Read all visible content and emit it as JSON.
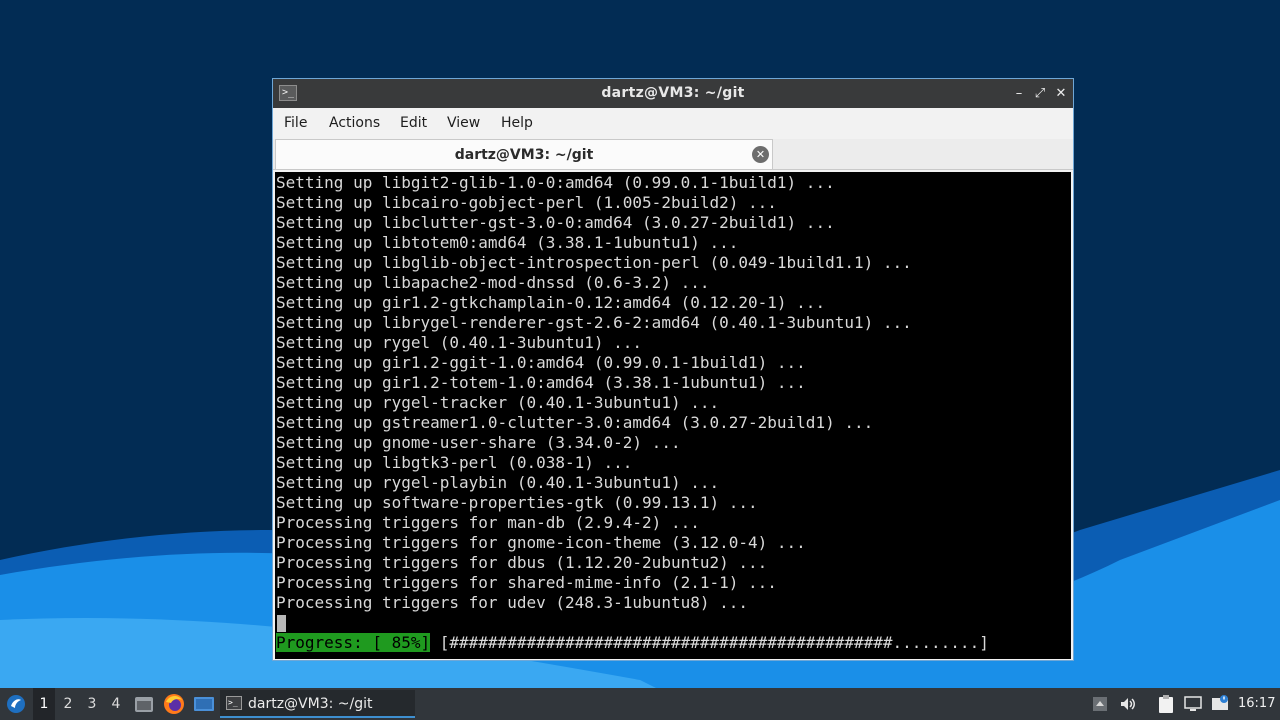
{
  "window": {
    "title": "dartz@VM3: ~/git",
    "controls": {
      "minimize": "–",
      "maximize": "⤢",
      "close": "✕"
    }
  },
  "menu": [
    "File",
    "Actions",
    "Edit",
    "View",
    "Help"
  ],
  "tab": {
    "title": "dartz@VM3: ~/git",
    "close": "✕"
  },
  "terminal": {
    "lines": [
      "Setting up libgit2-glib-1.0-0:amd64 (0.99.0.1-1build1) ...",
      "Setting up libcairo-gobject-perl (1.005-2build2) ...",
      "Setting up libclutter-gst-3.0-0:amd64 (3.0.27-2build1) ...",
      "Setting up libtotem0:amd64 (3.38.1-1ubuntu1) ...",
      "Setting up libglib-object-introspection-perl (0.049-1build1.1) ...",
      "Setting up libapache2-mod-dnssd (0.6-3.2) ...",
      "Setting up gir1.2-gtkchamplain-0.12:amd64 (0.12.20-1) ...",
      "Setting up librygel-renderer-gst-2.6-2:amd64 (0.40.1-3ubuntu1) ...",
      "Setting up rygel (0.40.1-3ubuntu1) ...",
      "Setting up gir1.2-ggit-1.0:amd64 (0.99.0.1-1build1) ...",
      "Setting up gir1.2-totem-1.0:amd64 (3.38.1-1ubuntu1) ...",
      "Setting up rygel-tracker (0.40.1-3ubuntu1) ...",
      "Setting up gstreamer1.0-clutter-3.0:amd64 (3.0.27-2build1) ...",
      "Setting up gnome-user-share (3.34.0-2) ...",
      "Setting up libgtk3-perl (0.038-1) ...",
      "Setting up rygel-playbin (0.40.1-3ubuntu1) ...",
      "Setting up software-properties-gtk (0.99.13.1) ...",
      "Processing triggers for man-db (2.9.4-2) ...",
      "Processing triggers for gnome-icon-theme (3.12.0-4) ...",
      "Processing triggers for dbus (1.12.20-2ubuntu2) ...",
      "Processing triggers for shared-mime-info (2.1-1) ...",
      "Processing triggers for udev (248.3-1ubuntu8) ..."
    ],
    "progress_label": "Progress: [ 85%]",
    "progress_bar": " [##############################################.........]",
    "progress_percent": 85
  },
  "taskbar": {
    "workspaces": [
      "1",
      "2",
      "3",
      "4"
    ],
    "active_workspace": "1",
    "task_label": "dartz@VM3: ~/git",
    "clock": "16:17",
    "tray_icons": [
      "up-arrow-icon",
      "volume-icon",
      "clipboard-icon",
      "network-icon",
      "update-notifier-icon"
    ]
  },
  "colors": {
    "desktop_bg": "#022c54",
    "wave_light": "#1a8fe8",
    "titlebar": "#393a3b",
    "progress_green": "#1f9a1f",
    "accent": "#3e8fd0"
  }
}
